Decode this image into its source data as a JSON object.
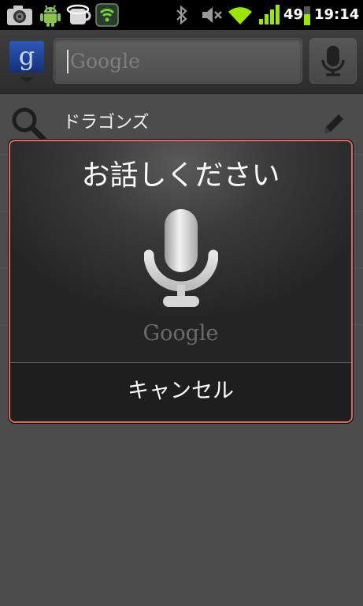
{
  "status_bar": {
    "battery_level": "49",
    "time": "19:14",
    "icons": [
      "camera-icon",
      "android-icon",
      "sync-icon",
      "network-shield-icon",
      "bluetooth-icon",
      "mute-icon",
      "wifi-icon",
      "signal-icon",
      "battery-icon"
    ]
  },
  "search": {
    "placeholder": "Google",
    "logo_letter": "g"
  },
  "suggestions": [
    {
      "text": "ドラゴンズ"
    }
  ],
  "voice_dialog": {
    "title": "お話しください",
    "logo": "Google",
    "cancel_label": "キャンセル"
  },
  "colors": {
    "dialog_border": "#e06a5a",
    "background": "#4c4c4c",
    "google_blue": "#2e58b8"
  }
}
